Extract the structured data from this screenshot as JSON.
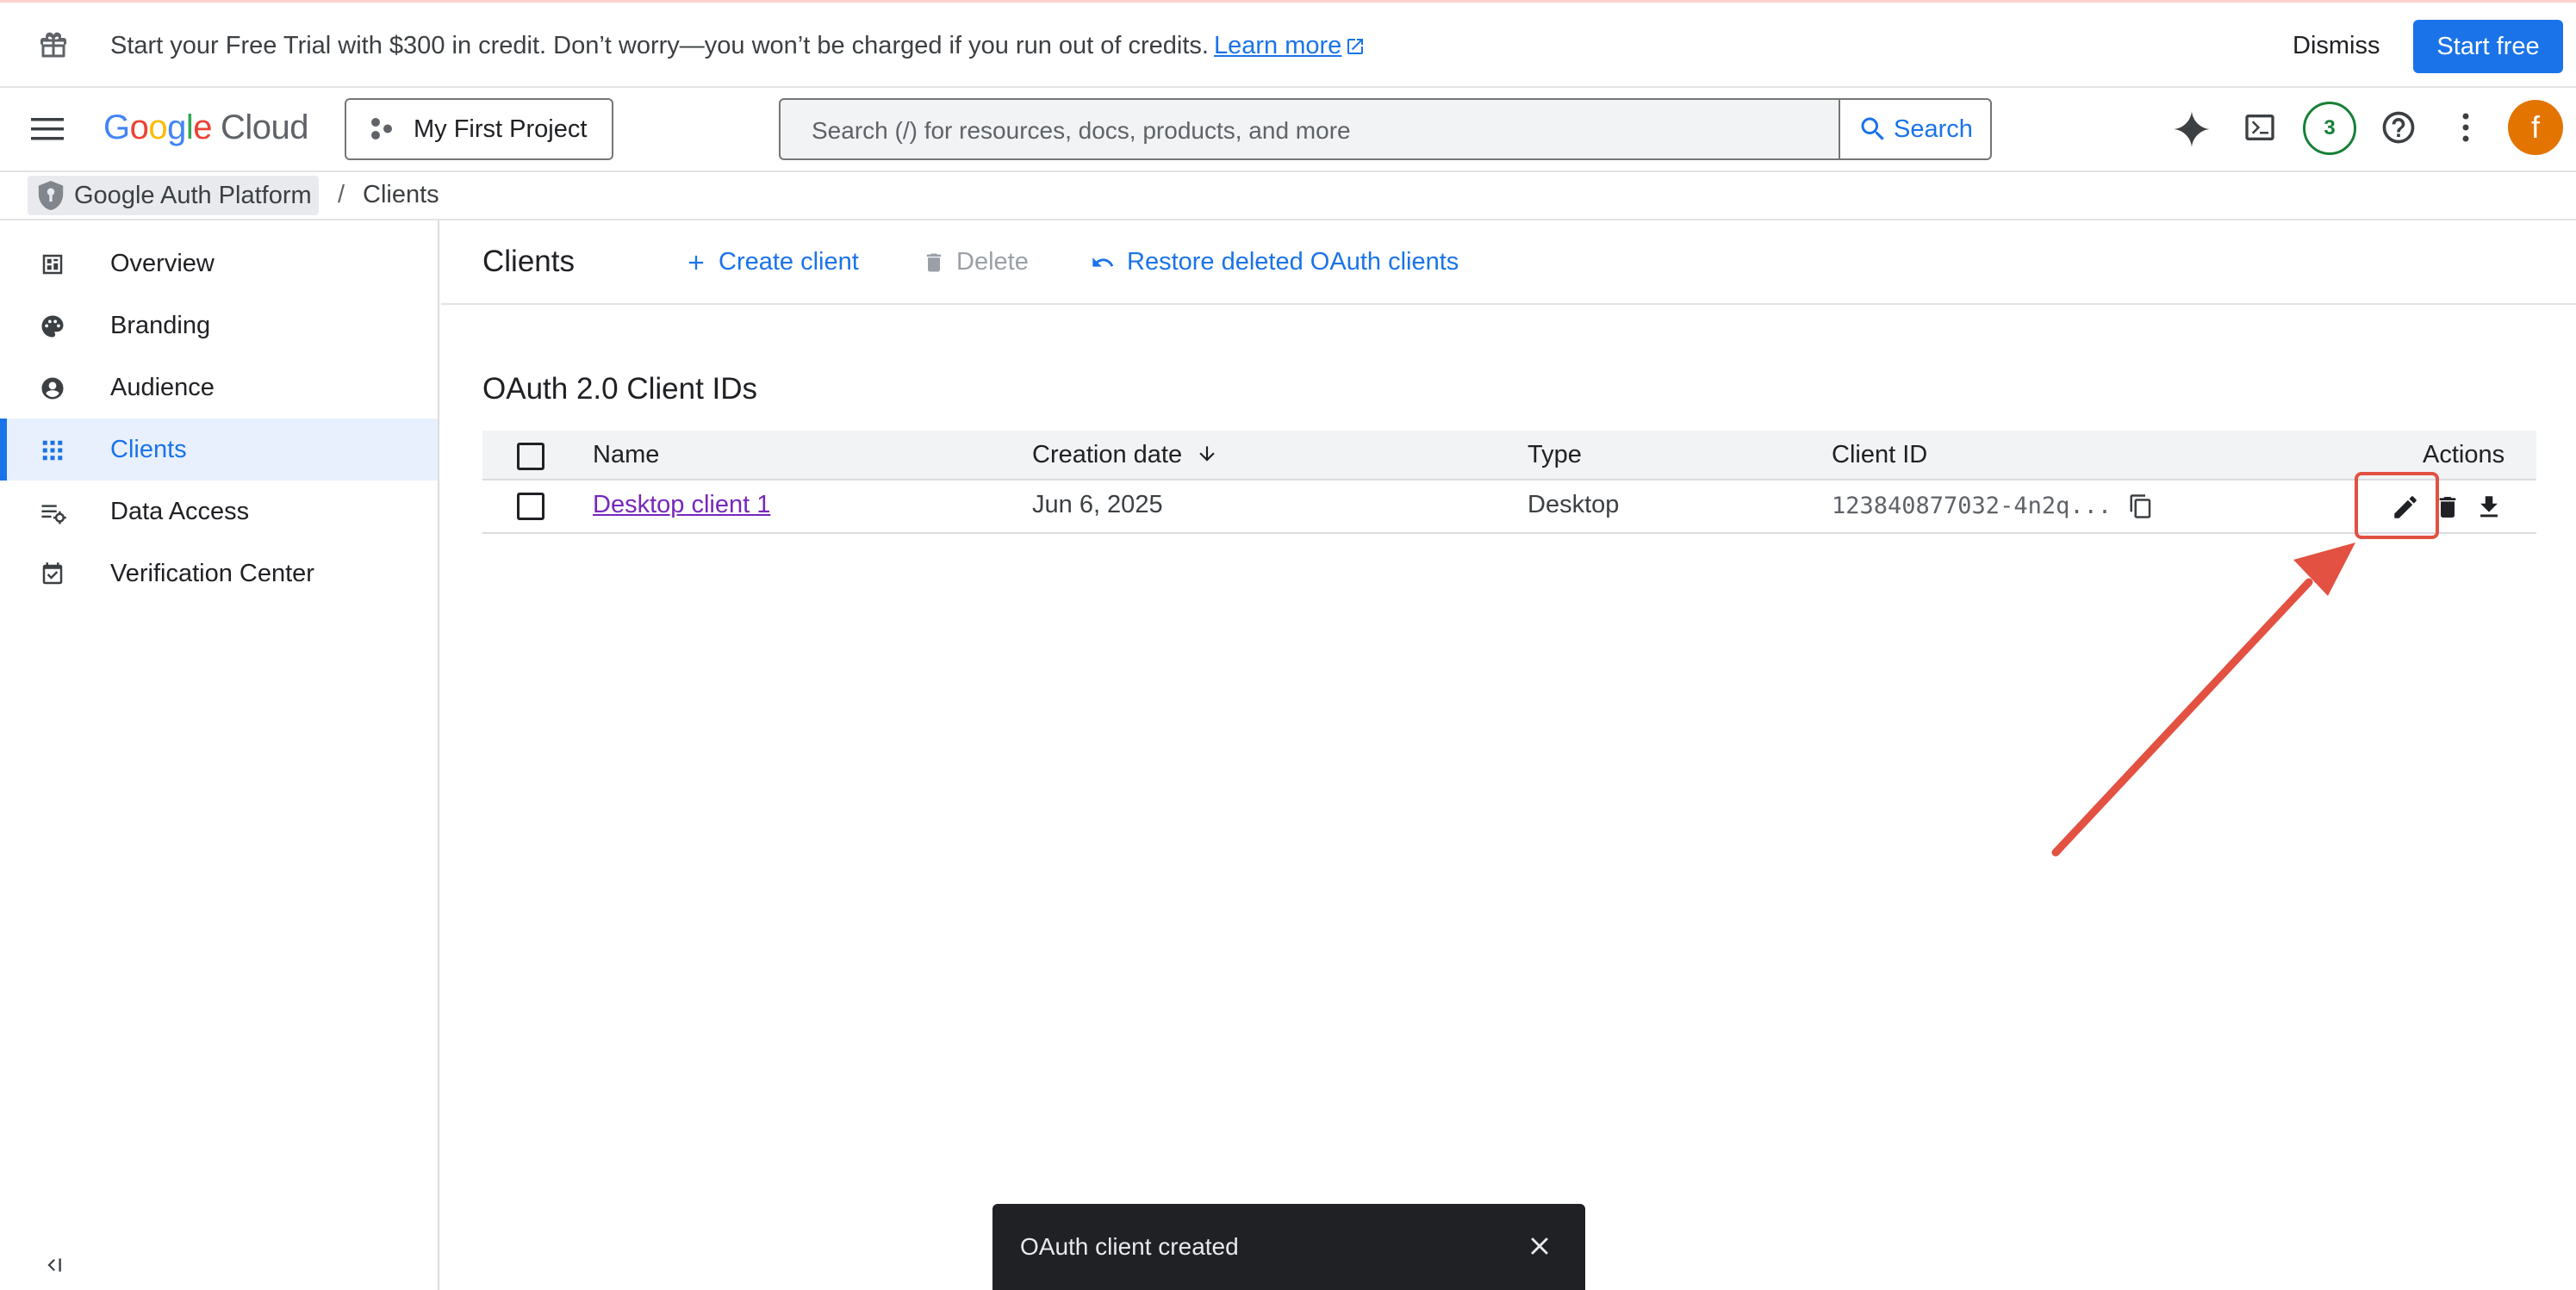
{
  "promo": {
    "message": "Start your Free Trial with $300 in credit. Don’t worry—you won’t be charged if you run out of credits.",
    "learn_more": "Learn more",
    "dismiss": "Dismiss",
    "start_free": "Start free"
  },
  "topbar": {
    "logo_word": "Google",
    "logo_cloud": "Cloud",
    "project": "My First Project",
    "search_placeholder": "Search (/) for resources, docs, products, and more",
    "search_button": "Search",
    "notifications_count": "3",
    "avatar_initial": "f"
  },
  "breadcrumb": {
    "root": "Google Auth Platform",
    "separator": "/",
    "current": "Clients"
  },
  "sidebar": {
    "items": [
      {
        "label": "Overview",
        "icon": "dashboard-icon"
      },
      {
        "label": "Branding",
        "icon": "palette-icon"
      },
      {
        "label": "Audience",
        "icon": "account-circle-icon"
      },
      {
        "label": "Clients",
        "icon": "apps-grid-icon",
        "active": true
      },
      {
        "label": "Data Access",
        "icon": "data-access-icon"
      },
      {
        "label": "Verification Center",
        "icon": "verified-checkbox-icon"
      }
    ]
  },
  "page": {
    "title": "Clients",
    "create_client": "Create client",
    "delete": "Delete",
    "restore": "Restore deleted OAuth clients"
  },
  "table": {
    "section_title": "OAuth 2.0 Client IDs",
    "columns": [
      "Name",
      "Creation date",
      "Type",
      "Client ID",
      "Actions"
    ],
    "rows": [
      {
        "name": "Desktop client 1",
        "creation_date": "Jun 6, 2025",
        "type": "Desktop",
        "client_id": "123840877032-4n2q..."
      }
    ]
  },
  "snackbar": {
    "message": "OAuth client created"
  },
  "colors": {
    "accent": "#1a73e8",
    "visited_link": "#7627bb",
    "annotation": "#e25141",
    "avatar": "#e37400",
    "badge": "#188038"
  }
}
